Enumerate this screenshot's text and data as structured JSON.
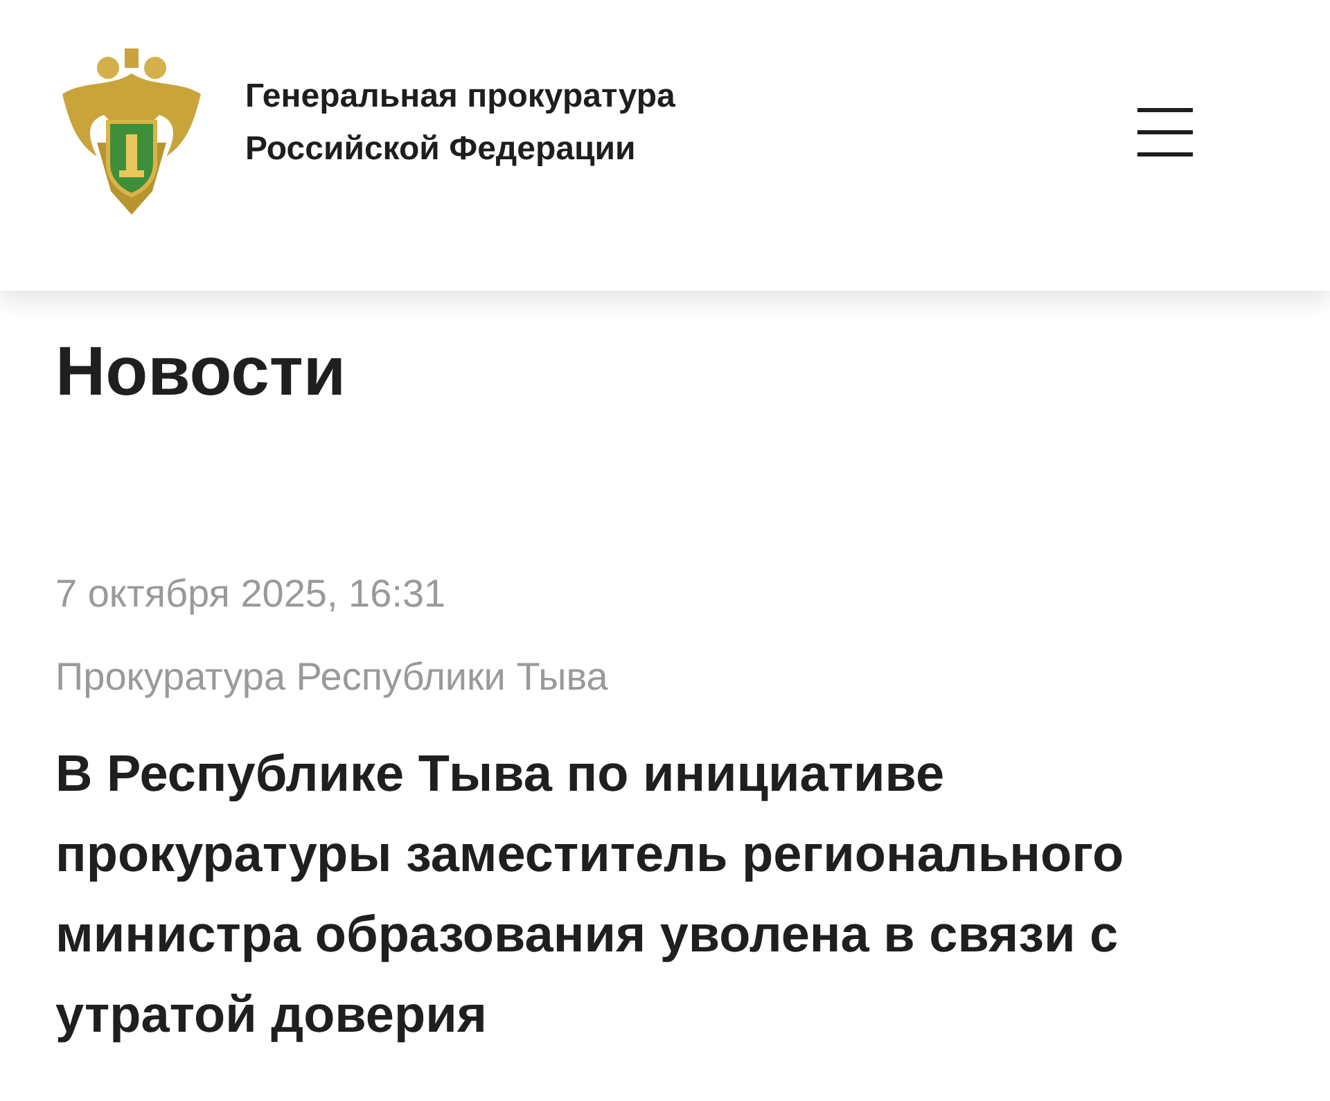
{
  "header": {
    "org_name_lines": [
      "Генеральная прокуратура",
      "Российской Федерации"
    ]
  },
  "page_title": "Новости",
  "article": {
    "date": "7 октября 2025, 16:31",
    "source": "Прокуратура Республики Тыва",
    "headline": "В Республике Тыва по инициативе прокуратуры заместитель регионального министра образования уволена в связи с утратой доверия"
  }
}
